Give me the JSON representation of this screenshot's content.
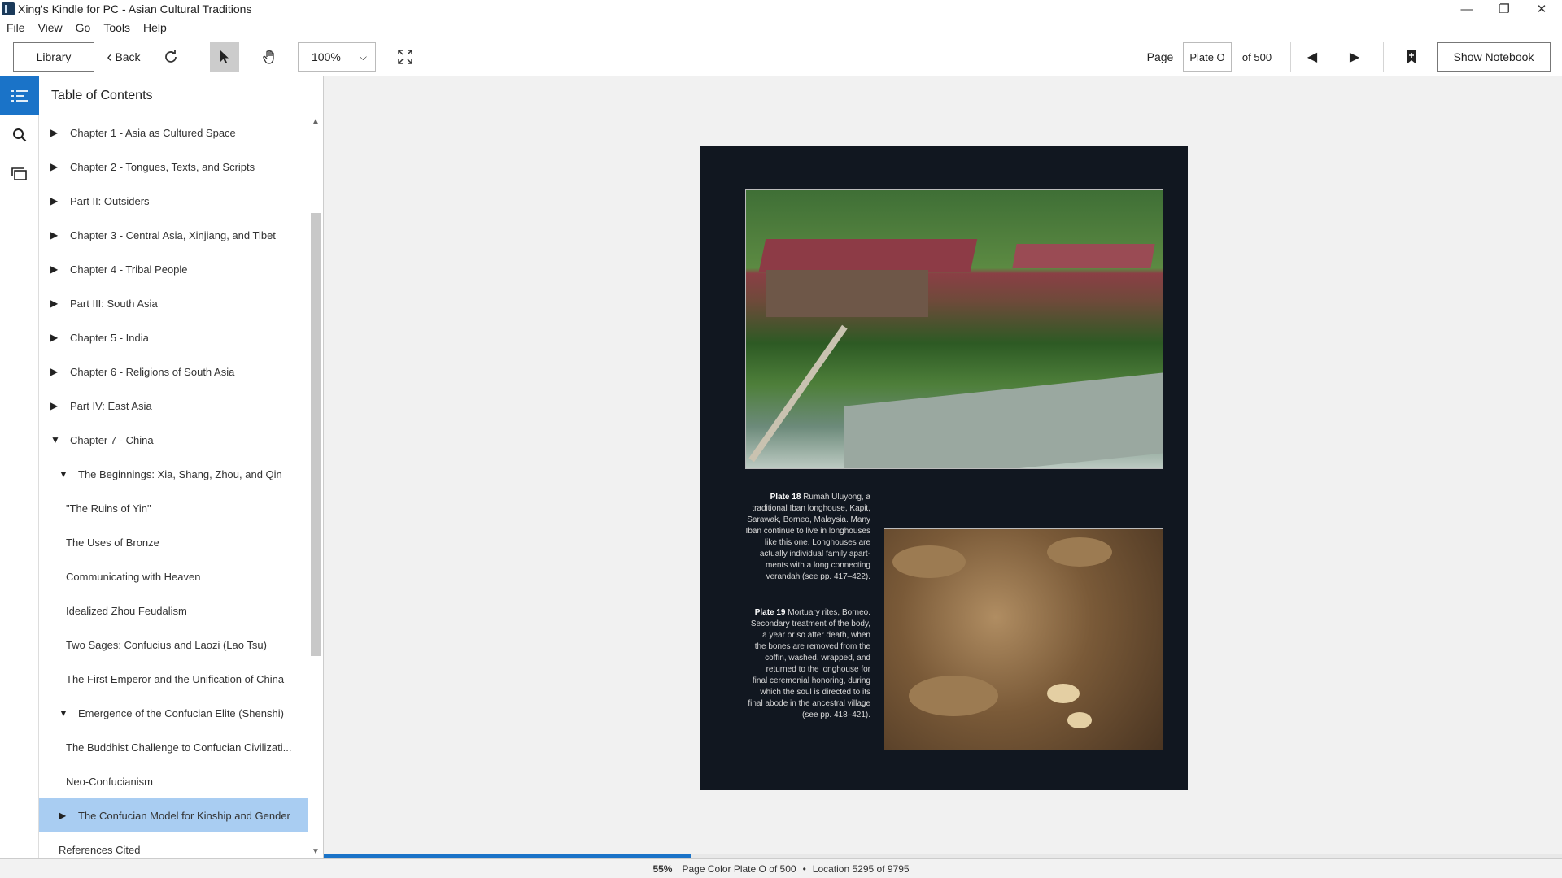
{
  "window": {
    "title": "Xing's Kindle for PC - Asian Cultural Traditions",
    "minimize": "—",
    "restore": "❐",
    "close": "✕"
  },
  "menu": [
    "File",
    "View",
    "Go",
    "Tools",
    "Help"
  ],
  "toolbar": {
    "library_label": "Library",
    "back_label": "Back",
    "zoom_value": "100%",
    "page_label": "Page",
    "page_value": "Plate O",
    "page_of": "of 500",
    "show_notebook_label": "Show Notebook"
  },
  "toc": {
    "title": "Table of Contents",
    "items": [
      {
        "label": "Chapter 1 - Asia as Cultured Space",
        "level": 0,
        "toggle": "collapsed"
      },
      {
        "label": "Chapter 2 - Tongues, Texts, and Scripts",
        "level": 0,
        "toggle": "collapsed"
      },
      {
        "label": "Part II: Outsiders",
        "level": 0,
        "toggle": "collapsed"
      },
      {
        "label": "Chapter 3 - Central Asia, Xinjiang, and Tibet",
        "level": 0,
        "toggle": "collapsed"
      },
      {
        "label": "Chapter 4 - Tribal People",
        "level": 0,
        "toggle": "collapsed"
      },
      {
        "label": "Part III: South Asia",
        "level": 0,
        "toggle": "collapsed"
      },
      {
        "label": "Chapter 5 - India",
        "level": 0,
        "toggle": "collapsed"
      },
      {
        "label": "Chapter 6 - Religions of South Asia",
        "level": 0,
        "toggle": "collapsed"
      },
      {
        "label": "Part IV: East Asia",
        "level": 0,
        "toggle": "collapsed"
      },
      {
        "label": "Chapter 7 - China",
        "level": 0,
        "toggle": "expanded"
      },
      {
        "label": "The Beginnings: Xia, Shang, Zhou, and Qin",
        "level": 1,
        "toggle": "expanded"
      },
      {
        "label": "\"The Ruins of Yin\"",
        "level": 2,
        "toggle": "none"
      },
      {
        "label": "The Uses of Bronze",
        "level": 2,
        "toggle": "none"
      },
      {
        "label": "Communicating with Heaven",
        "level": 2,
        "toggle": "none"
      },
      {
        "label": "Idealized Zhou Feudalism",
        "level": 2,
        "toggle": "none"
      },
      {
        "label": "Two Sages: Confucius and Laozi (Lao Tsu)",
        "level": 2,
        "toggle": "none"
      },
      {
        "label": "The First Emperor and the Unification of China",
        "level": 2,
        "toggle": "none"
      },
      {
        "label": "Emergence of the Confucian Elite (Shenshi)",
        "level": 1,
        "toggle": "expanded"
      },
      {
        "label": "The Buddhist Challenge to Confucian Civilizati...",
        "level": 2,
        "toggle": "none"
      },
      {
        "label": "Neo-Confucianism",
        "level": 2,
        "toggle": "none"
      },
      {
        "label": "The Confucian Model for Kinship and Gender",
        "level": 1,
        "toggle": "collapsed",
        "selected": true
      },
      {
        "label": "References Cited",
        "level": 1,
        "toggle": "none"
      }
    ]
  },
  "page": {
    "caption1_title": "Plate 18",
    "caption1_lines": [
      "Rumah Uluyong, a",
      "traditional Iban longhouse, Kapit,",
      "Sarawak, Borneo, Malaysia. Many",
      "Iban continue to live in longhouses",
      "like this one. Longhouses are",
      "actually individual family apart-",
      "ments with a long connecting",
      "verandah (see pp. 417–422)."
    ],
    "caption2_title": "Plate 19",
    "caption2_lines": [
      "Mortuary rites, Borneo.",
      "Secondary treatment of the body,",
      "a year or so after death, when",
      "the bones are removed from the",
      "coffin, washed, wrapped, and",
      "returned to the longhouse for",
      "final ceremonial honoring, during",
      "which the soul is directed to its",
      "final abode in the ancestral village",
      "(see pp. 418–421)."
    ]
  },
  "status": {
    "percent": "55%",
    "progress_fraction": 0.55,
    "page_color_text": "Page Color Plate O of 500",
    "separator": "•",
    "location_text": "Location 5295 of 9795"
  },
  "colors": {
    "accent": "#1a73c8",
    "selection": "#a9cdf2",
    "page_bg": "#111720"
  }
}
